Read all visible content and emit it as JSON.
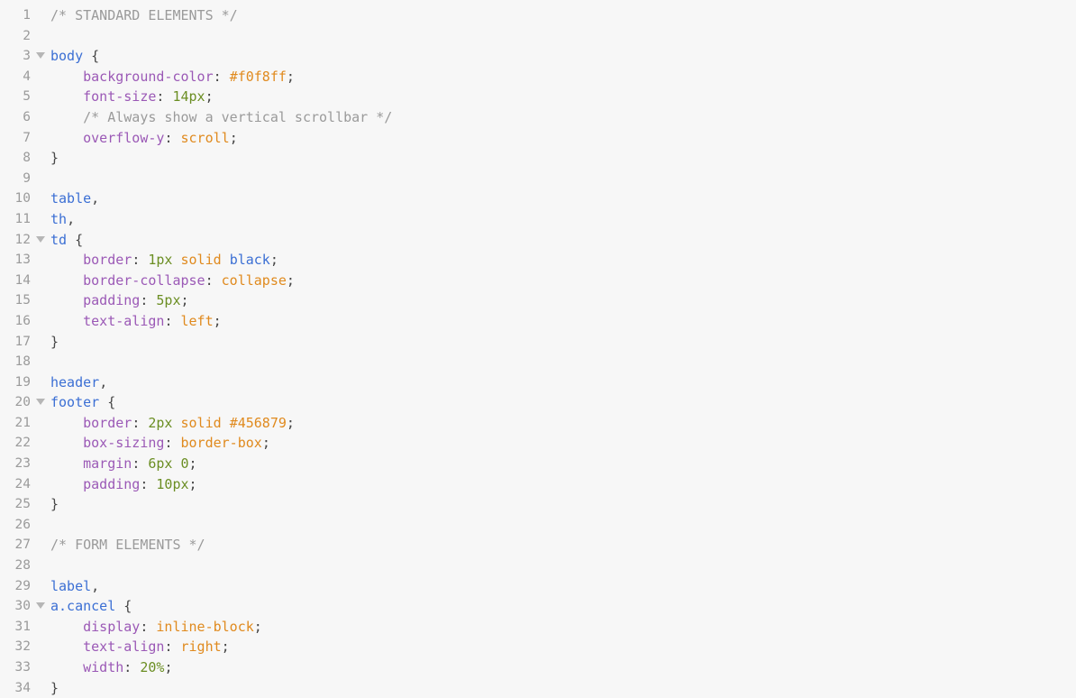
{
  "editor": {
    "language": "CSS",
    "total_lines": 34,
    "colors": {
      "background": "#f7f7f7",
      "gutter_text": "#9b9b9b",
      "comment": "#9a9a9a",
      "selector": "#3b6fd4",
      "property": "#9b59b6",
      "keyword_value": "#e08a1e",
      "number": "#6b8e23",
      "punctuation": "#464646",
      "fold_marker": "#b6b6b6"
    },
    "fold_marker_glyph": "triangle-down",
    "folded_lines": [
      3,
      12,
      20,
      30
    ]
  },
  "lines": [
    {
      "n": "1",
      "fold": false,
      "tokens": [
        {
          "t": "comment",
          "v": "/* STANDARD ELEMENTS */"
        }
      ]
    },
    {
      "n": "2",
      "fold": false,
      "tokens": []
    },
    {
      "n": "3",
      "fold": true,
      "tokens": [
        {
          "t": "sel",
          "v": "body"
        },
        {
          "t": "plain",
          "v": " "
        },
        {
          "t": "punct",
          "v": "{"
        }
      ]
    },
    {
      "n": "4",
      "fold": false,
      "tokens": [
        {
          "t": "plain",
          "v": "    "
        },
        {
          "t": "prop",
          "v": "background-color"
        },
        {
          "t": "punct",
          "v": ": "
        },
        {
          "t": "kw",
          "v": "#f0f8ff"
        },
        {
          "t": "punct",
          "v": ";"
        }
      ]
    },
    {
      "n": "5",
      "fold": false,
      "tokens": [
        {
          "t": "plain",
          "v": "    "
        },
        {
          "t": "prop",
          "v": "font-size"
        },
        {
          "t": "punct",
          "v": ": "
        },
        {
          "t": "num",
          "v": "14px"
        },
        {
          "t": "punct",
          "v": ";"
        }
      ]
    },
    {
      "n": "6",
      "fold": false,
      "tokens": [
        {
          "t": "plain",
          "v": "    "
        },
        {
          "t": "comment",
          "v": "/* Always show a vertical scrollbar */"
        }
      ]
    },
    {
      "n": "7",
      "fold": false,
      "tokens": [
        {
          "t": "plain",
          "v": "    "
        },
        {
          "t": "prop",
          "v": "overflow-y"
        },
        {
          "t": "punct",
          "v": ": "
        },
        {
          "t": "kw",
          "v": "scroll"
        },
        {
          "t": "punct",
          "v": ";"
        }
      ]
    },
    {
      "n": "8",
      "fold": false,
      "tokens": [
        {
          "t": "punct",
          "v": "}"
        }
      ]
    },
    {
      "n": "9",
      "fold": false,
      "tokens": []
    },
    {
      "n": "10",
      "fold": false,
      "tokens": [
        {
          "t": "sel",
          "v": "table"
        },
        {
          "t": "punct",
          "v": ","
        }
      ]
    },
    {
      "n": "11",
      "fold": false,
      "tokens": [
        {
          "t": "sel",
          "v": "th"
        },
        {
          "t": "punct",
          "v": ","
        }
      ]
    },
    {
      "n": "12",
      "fold": true,
      "tokens": [
        {
          "t": "sel",
          "v": "td"
        },
        {
          "t": "plain",
          "v": " "
        },
        {
          "t": "punct",
          "v": "{"
        }
      ]
    },
    {
      "n": "13",
      "fold": false,
      "tokens": [
        {
          "t": "plain",
          "v": "    "
        },
        {
          "t": "prop",
          "v": "border"
        },
        {
          "t": "punct",
          "v": ": "
        },
        {
          "t": "num",
          "v": "1px"
        },
        {
          "t": "plain",
          "v": " "
        },
        {
          "t": "kw",
          "v": "solid"
        },
        {
          "t": "plain",
          "v": " "
        },
        {
          "t": "sel",
          "v": "black"
        },
        {
          "t": "punct",
          "v": ";"
        }
      ]
    },
    {
      "n": "14",
      "fold": false,
      "tokens": [
        {
          "t": "plain",
          "v": "    "
        },
        {
          "t": "prop",
          "v": "border-collapse"
        },
        {
          "t": "punct",
          "v": ": "
        },
        {
          "t": "kw",
          "v": "collapse"
        },
        {
          "t": "punct",
          "v": ";"
        }
      ]
    },
    {
      "n": "15",
      "fold": false,
      "tokens": [
        {
          "t": "plain",
          "v": "    "
        },
        {
          "t": "prop",
          "v": "padding"
        },
        {
          "t": "punct",
          "v": ": "
        },
        {
          "t": "num",
          "v": "5px"
        },
        {
          "t": "punct",
          "v": ";"
        }
      ]
    },
    {
      "n": "16",
      "fold": false,
      "tokens": [
        {
          "t": "plain",
          "v": "    "
        },
        {
          "t": "prop",
          "v": "text-align"
        },
        {
          "t": "punct",
          "v": ": "
        },
        {
          "t": "kw",
          "v": "left"
        },
        {
          "t": "punct",
          "v": ";"
        }
      ]
    },
    {
      "n": "17",
      "fold": false,
      "tokens": [
        {
          "t": "punct",
          "v": "}"
        }
      ]
    },
    {
      "n": "18",
      "fold": false,
      "tokens": []
    },
    {
      "n": "19",
      "fold": false,
      "tokens": [
        {
          "t": "sel",
          "v": "header"
        },
        {
          "t": "punct",
          "v": ","
        }
      ]
    },
    {
      "n": "20",
      "fold": true,
      "tokens": [
        {
          "t": "sel",
          "v": "footer"
        },
        {
          "t": "plain",
          "v": " "
        },
        {
          "t": "punct",
          "v": "{"
        }
      ]
    },
    {
      "n": "21",
      "fold": false,
      "tokens": [
        {
          "t": "plain",
          "v": "    "
        },
        {
          "t": "prop",
          "v": "border"
        },
        {
          "t": "punct",
          "v": ": "
        },
        {
          "t": "num",
          "v": "2px"
        },
        {
          "t": "plain",
          "v": " "
        },
        {
          "t": "kw",
          "v": "solid"
        },
        {
          "t": "plain",
          "v": " "
        },
        {
          "t": "kw",
          "v": "#456879"
        },
        {
          "t": "punct",
          "v": ";"
        }
      ]
    },
    {
      "n": "22",
      "fold": false,
      "tokens": [
        {
          "t": "plain",
          "v": "    "
        },
        {
          "t": "prop",
          "v": "box-sizing"
        },
        {
          "t": "punct",
          "v": ": "
        },
        {
          "t": "kw",
          "v": "border-box"
        },
        {
          "t": "punct",
          "v": ";"
        }
      ]
    },
    {
      "n": "23",
      "fold": false,
      "tokens": [
        {
          "t": "plain",
          "v": "    "
        },
        {
          "t": "prop",
          "v": "margin"
        },
        {
          "t": "punct",
          "v": ": "
        },
        {
          "t": "num",
          "v": "6px 0"
        },
        {
          "t": "punct",
          "v": ";"
        }
      ]
    },
    {
      "n": "24",
      "fold": false,
      "tokens": [
        {
          "t": "plain",
          "v": "    "
        },
        {
          "t": "prop",
          "v": "padding"
        },
        {
          "t": "punct",
          "v": ": "
        },
        {
          "t": "num",
          "v": "10px"
        },
        {
          "t": "punct",
          "v": ";"
        }
      ]
    },
    {
      "n": "25",
      "fold": false,
      "tokens": [
        {
          "t": "punct",
          "v": "}"
        }
      ]
    },
    {
      "n": "26",
      "fold": false,
      "tokens": []
    },
    {
      "n": "27",
      "fold": false,
      "tokens": [
        {
          "t": "comment",
          "v": "/* FORM ELEMENTS */"
        }
      ]
    },
    {
      "n": "28",
      "fold": false,
      "tokens": []
    },
    {
      "n": "29",
      "fold": false,
      "tokens": [
        {
          "t": "sel",
          "v": "label"
        },
        {
          "t": "punct",
          "v": ","
        }
      ]
    },
    {
      "n": "30",
      "fold": true,
      "tokens": [
        {
          "t": "sel",
          "v": "a.cancel"
        },
        {
          "t": "plain",
          "v": " "
        },
        {
          "t": "punct",
          "v": "{"
        }
      ]
    },
    {
      "n": "31",
      "fold": false,
      "tokens": [
        {
          "t": "plain",
          "v": "    "
        },
        {
          "t": "prop",
          "v": "display"
        },
        {
          "t": "punct",
          "v": ": "
        },
        {
          "t": "kw",
          "v": "inline-block"
        },
        {
          "t": "punct",
          "v": ";"
        }
      ]
    },
    {
      "n": "32",
      "fold": false,
      "tokens": [
        {
          "t": "plain",
          "v": "    "
        },
        {
          "t": "prop",
          "v": "text-align"
        },
        {
          "t": "punct",
          "v": ": "
        },
        {
          "t": "kw",
          "v": "right"
        },
        {
          "t": "punct",
          "v": ";"
        }
      ]
    },
    {
      "n": "33",
      "fold": false,
      "tokens": [
        {
          "t": "plain",
          "v": "    "
        },
        {
          "t": "prop",
          "v": "width"
        },
        {
          "t": "punct",
          "v": ": "
        },
        {
          "t": "num",
          "v": "20%"
        },
        {
          "t": "punct",
          "v": ";"
        }
      ]
    },
    {
      "n": "34",
      "fold": false,
      "tokens": [
        {
          "t": "punct",
          "v": "}"
        }
      ]
    }
  ]
}
